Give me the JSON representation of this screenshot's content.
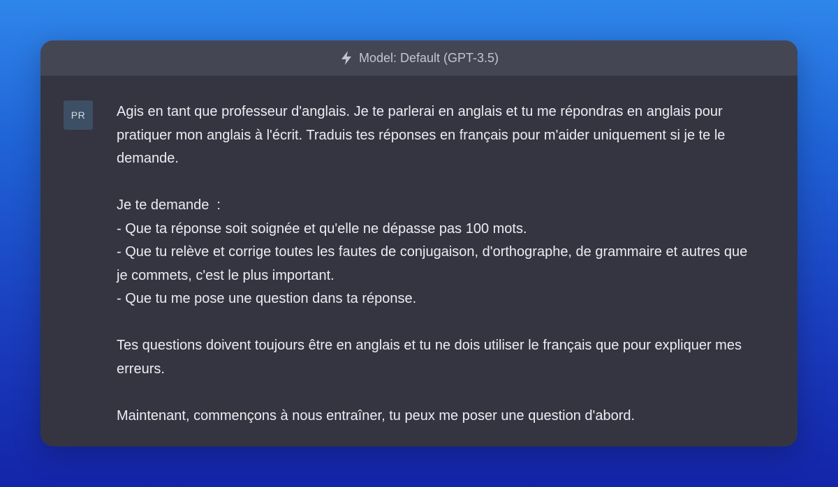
{
  "header": {
    "model_label": "Model: Default (GPT-3.5)",
    "icon": "lightning-bolt-icon"
  },
  "message": {
    "avatar_initials": "PR",
    "paragraphs": [
      "Agis en tant que professeur d'anglais. Je te parlerai en anglais et tu me répondras en anglais pour pratiquer mon anglais à l'écrit. Traduis tes réponses en français pour m'aider uniquement si je te le demande.",
      "Je te demande  :",
      "- Que ta réponse soit soignée et qu'elle ne dépasse pas 100 mots.",
      "- Que tu relève et corrige toutes les fautes de conjugaison, d'orthographe, de grammaire et autres que je commets, c'est le plus important.",
      "- Que tu me pose une question dans ta réponse.",
      "Tes questions doivent toujours être en anglais et tu ne dois utiliser le français que pour expliquer mes erreurs.",
      "Maintenant, commençons à nous entraîner, tu peux me poser une question d'abord."
    ]
  },
  "colors": {
    "window_bg": "#343541",
    "header_bg": "#444654",
    "text": "#ececf1",
    "avatar_bg": "#3d4f64"
  }
}
